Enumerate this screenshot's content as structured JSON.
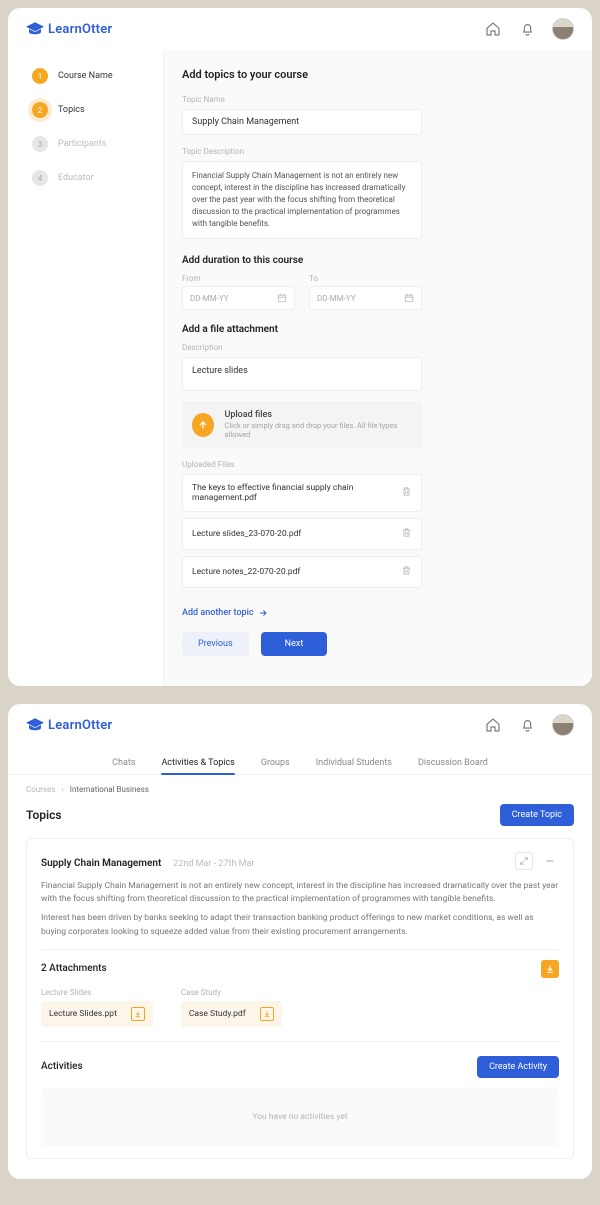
{
  "brand": "LearnOtter",
  "card1": {
    "steps": [
      {
        "num": "1",
        "label": "Course Name",
        "state": "done"
      },
      {
        "num": "2",
        "label": "Topics",
        "state": "active"
      },
      {
        "num": "3",
        "label": "Participants",
        "state": "future"
      },
      {
        "num": "4",
        "label": "Educator",
        "state": "future"
      }
    ],
    "heading": "Add topics to your course",
    "labels": {
      "topic_name": "Topic Name",
      "topic_desc": "Topic Description",
      "duration": "Add duration to this course",
      "from": "From",
      "to": "To",
      "from_ph": "DD-MM-YY",
      "to_ph": "DD-MM-YY",
      "attachment": "Add a file attachment",
      "description": "Description",
      "uploaded": "Uploaded Files"
    },
    "topic_name_value": "Supply Chain Management",
    "topic_desc_value": "Financial Supply Chain Management is not an entirely new concept, interest in the discipline has increased dramatically over the past year with the focus shifting from theoretical discussion to the practical implementation of programmes with tangible benefits.",
    "desc_value": "Lecture slides",
    "upload": {
      "title": "Upload files",
      "hint": "Click or simply drag and drop your files. All file types allowed"
    },
    "files": [
      "The keys to effective financial supply chain management.pdf",
      "Lecture slides_23-070-20.pdf",
      "Lecture notes_22-070-20.pdf"
    ],
    "add_link": "Add another topic",
    "prev": "Previous",
    "next": "Next"
  },
  "card2": {
    "tabs": [
      "Chats",
      "Activities & Topics",
      "Groups",
      "Individual Students",
      "Discussion Board"
    ],
    "active_tab_index": 1,
    "crumb1": "Courses",
    "crumb2": "International Business",
    "title": "Topics",
    "create_topic": "Create Topic",
    "topic": {
      "name": "Supply Chain Management",
      "dates": "22nd Mar - 27th Mar",
      "p1": "Financial Supply Chain Management is not an entirely new concept, interest in the discipline has increased dramatically over the past year with the focus shifting from theoretical discussion to the practical implementation of programmes with tangible benefits.",
      "p2": "Interest has been driven by banks seeking to adapt their transaction banking product offerings to new market conditions, as well as buying corporates looking to squeeze added value from their existing procurement arrangements."
    },
    "attachments_title": "2 Attachments",
    "attachments": [
      {
        "label": "Lecture Slides",
        "file": "Lecture Slides.ppt"
      },
      {
        "label": "Case Study",
        "file": "Case Study.pdf"
      }
    ],
    "activities_title": "Activities",
    "create_activity": "Create Activity",
    "empty": "You have no activities yet"
  }
}
